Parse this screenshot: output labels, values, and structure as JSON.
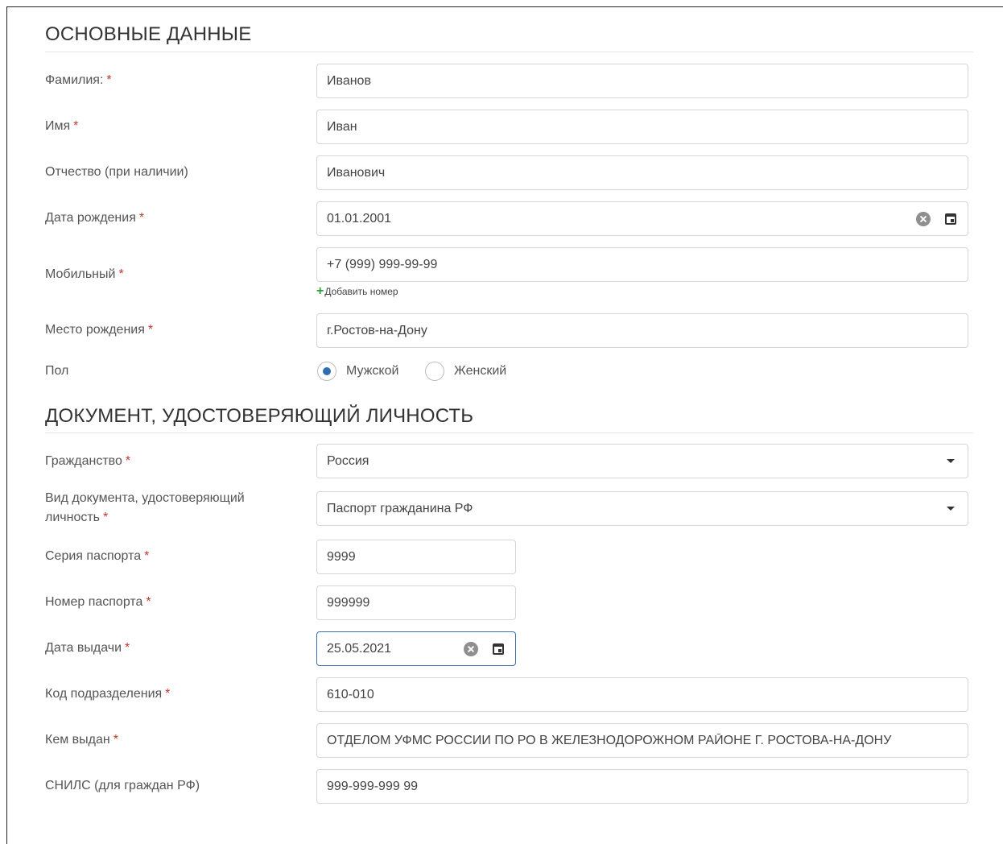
{
  "sections": {
    "basic": "ОСНОВНЫЕ ДАННЫЕ",
    "document": "ДОКУМЕНТ, УДОСТОВЕРЯЮЩИЙ ЛИЧНОСТЬ"
  },
  "required_mark": "*",
  "fields": {
    "surname": {
      "label": "Фамилия:",
      "value": "Иванов"
    },
    "name": {
      "label": "Имя",
      "value": "Иван"
    },
    "patronymic": {
      "label": "Отчество (при наличии)",
      "value": "Иванович"
    },
    "birth_date": {
      "label": "Дата рождения",
      "value": "01.01.2001"
    },
    "mobile": {
      "label": "Мобильный",
      "value": "+7 (999) 999-99-99",
      "add_label": "Добавить номер"
    },
    "birth_place": {
      "label": "Место рождения",
      "value": "г.Ростов-на-Дону"
    },
    "gender": {
      "label": "Пол",
      "options": [
        "Мужской",
        "Женский"
      ],
      "selected": "Мужской"
    },
    "citizenship": {
      "label": "Гражданство",
      "value": "Россия"
    },
    "doc_type": {
      "label_line1": "Вид документа, удостоверяющий",
      "label_line2": "личность",
      "value": "Паспорт гражданина РФ"
    },
    "passport_series": {
      "label": "Серия паспорта",
      "value": "9999"
    },
    "passport_number": {
      "label": "Номер паспорта",
      "value": "999999"
    },
    "issue_date": {
      "label": "Дата выдачи",
      "value": "25.05.2021"
    },
    "division_code": {
      "label": "Код подразделения",
      "value": "610-010"
    },
    "issued_by": {
      "label": "Кем выдан",
      "value": "ОТДЕЛОМ УФМС РОССИИ ПО РО В ЖЕЛЕЗНОДОРОЖНОМ РАЙОНЕ Г. РОСТОВА-НА-ДОНУ"
    },
    "snils": {
      "label": "СНИЛС (для граждан РФ)",
      "value": "999-999-999 99"
    }
  },
  "colors": {
    "accent": "#2f6fb1",
    "required": "#c0392b",
    "add": "#2e9e2e"
  }
}
